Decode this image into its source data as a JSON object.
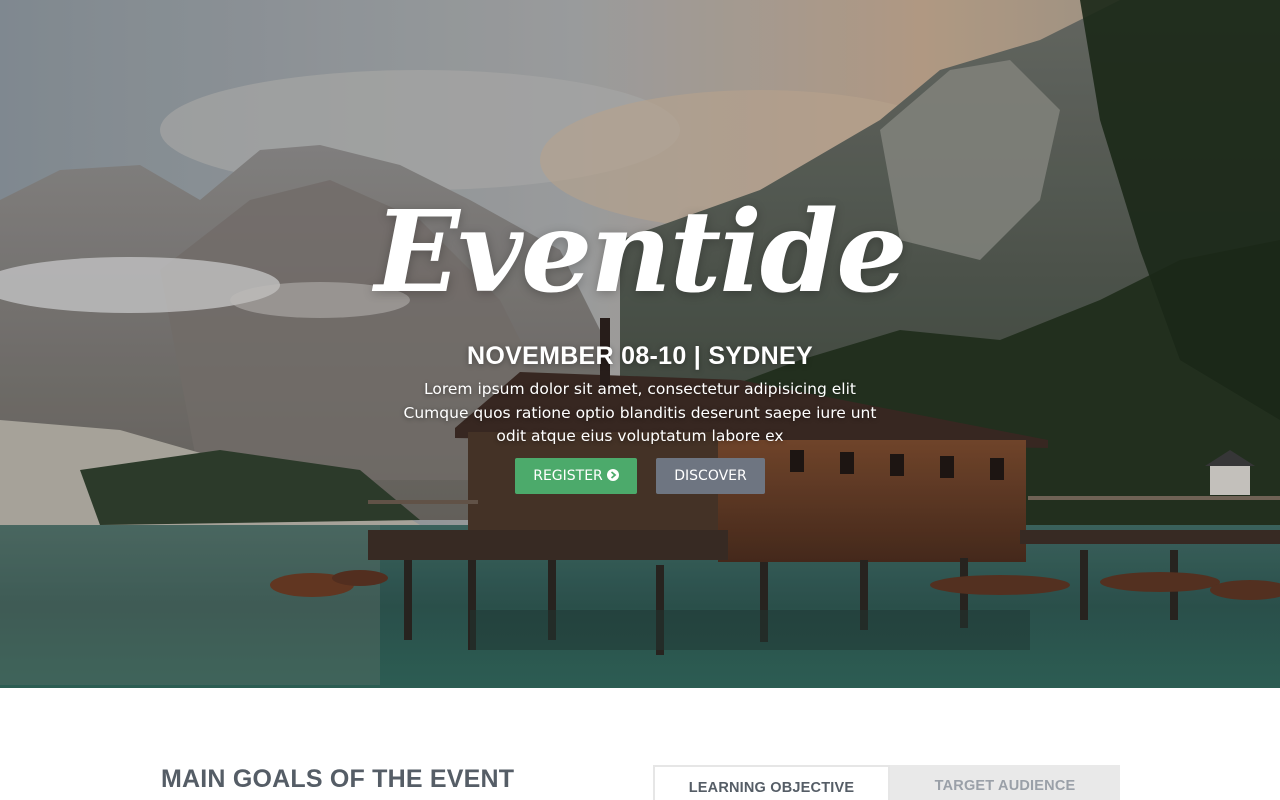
{
  "hero": {
    "logo_text": "Eventide",
    "dateline": "NOVEMBER 08-10 | SYDNEY",
    "tagline": "Lorem ipsum dolor sit amet, consectetur adipisicing elit Cumque quos ratione optio blanditis deserunt saepe iure unt odit atque eius voluptatum labore ex",
    "register_label": "REGISTER",
    "register_icon": "chevron-circle-right-icon",
    "discover_label": "DISCOVER"
  },
  "goals": {
    "title": "MAIN GOALS OF THE EVENT",
    "tabs": [
      {
        "label": "LEARNING OBJECTIVE",
        "active": true
      },
      {
        "label": "TARGET AUDIENCE",
        "active": false
      }
    ]
  },
  "colors": {
    "register_button": "#4caa6b",
    "discover_button": "#6e7581",
    "heading_text": "#555d66",
    "inactive_tab_bg": "#e9e9e9"
  }
}
